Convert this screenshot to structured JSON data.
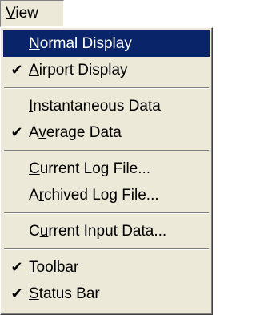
{
  "menu": {
    "title": "View",
    "title_mnemonic_index": 0
  },
  "items": [
    {
      "label": "Normal Display",
      "mnemonic": 0,
      "checked": false,
      "highlighted": true
    },
    {
      "label": "Airport Display",
      "mnemonic": 0,
      "checked": true,
      "highlighted": false
    },
    {
      "separator": true
    },
    {
      "label": "Instantaneous Data",
      "mnemonic": 0,
      "checked": false,
      "highlighted": false
    },
    {
      "label": "Average Data",
      "mnemonic": 1,
      "checked": true,
      "highlighted": false
    },
    {
      "separator": true
    },
    {
      "label": "Current Log File...",
      "mnemonic": 0,
      "checked": false,
      "highlighted": false
    },
    {
      "label": "Archived Log File...",
      "mnemonic": 1,
      "checked": false,
      "highlighted": false
    },
    {
      "separator": true
    },
    {
      "label": "Current Input Data...",
      "mnemonic": 1,
      "checked": false,
      "highlighted": false
    },
    {
      "separator": true
    },
    {
      "label": "Toolbar",
      "mnemonic": 0,
      "checked": true,
      "highlighted": false
    },
    {
      "label": "Status Bar",
      "mnemonic": 0,
      "checked": true,
      "highlighted": false
    }
  ],
  "check_glyph": "✔",
  "colors": {
    "menu_bg": "#ece9d8",
    "highlight_bg": "#0a246a",
    "highlight_fg": "#ffffff",
    "text": "#000000"
  }
}
